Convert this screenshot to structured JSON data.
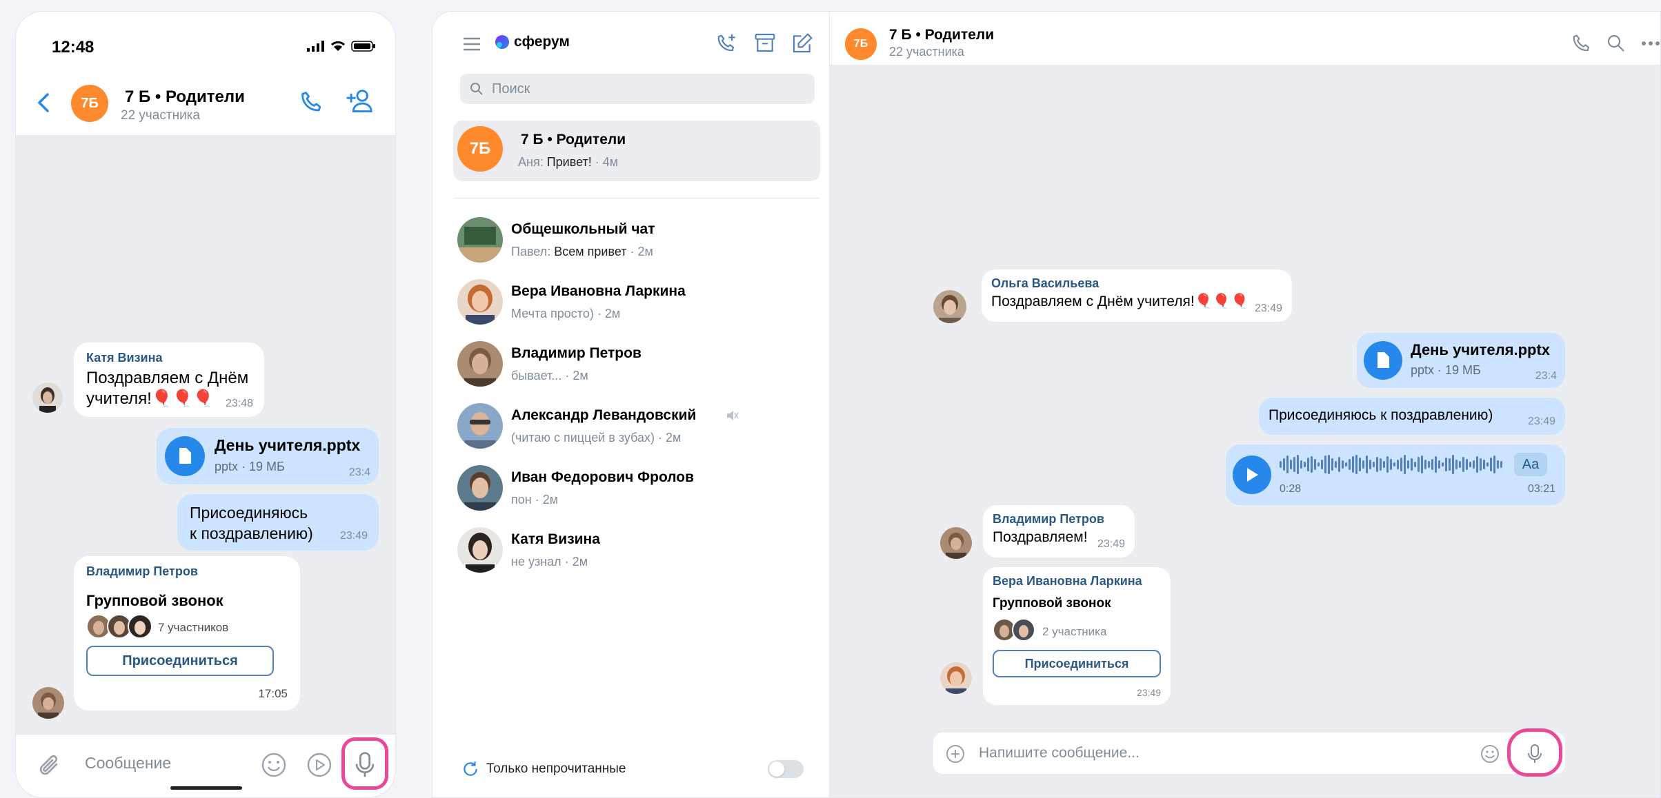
{
  "colors": {
    "accent": "#2688eb",
    "group_avatar": "#ff8a2e",
    "bubble_out": "#cce4ff",
    "bubble_in": "#ffffff",
    "chat_bg": "#ebedf0",
    "highlight": "#ec4899"
  },
  "phone": {
    "status": {
      "time": "12:48"
    },
    "header": {
      "avatar": "7Б",
      "title": "7 Б • Родители",
      "subtitle": "22 участника"
    },
    "messages": {
      "m1": {
        "sender": "Катя Визина",
        "line1": "Поздравляем с Днём",
        "line2": "учителя!🎈🎈🎈",
        "time": "23:48"
      },
      "m2": {
        "file": "День учителя.pptx",
        "meta": "pptx · 19 МБ",
        "time": "23:4"
      },
      "m3": {
        "line1": "Присоединяюсь",
        "line2": "к поздравлению)",
        "time": "23:49"
      },
      "m4": {
        "sender": "Владимир Петров",
        "title": "Групповой звонок",
        "participants": "7 участников",
        "button": "Присоединиться",
        "time": "17:05"
      }
    },
    "input": {
      "placeholder": "Сообщение"
    }
  },
  "desktop": {
    "brand": "сферум",
    "search_placeholder": "Поиск",
    "conversations": [
      {
        "avatar": "7Б",
        "name": "7 Б • Родители",
        "author": "Аня:",
        "text": "Привет!",
        "time": "· 4м"
      },
      {
        "name": "Общешкольный чат",
        "author": "Павел:",
        "text": "Всем привет",
        "time": "· 2м"
      },
      {
        "name": "Вера Ивановна Ларкина",
        "author": "",
        "text": "Мечта просто)",
        "time": "· 2м"
      },
      {
        "name": "Владимир Петров",
        "author": "",
        "text": "бывает...",
        "time": "· 2м"
      },
      {
        "name": "Александр Левандовский",
        "author": "",
        "text": "(читаю с пиццей в зубах)",
        "time": "· 2м"
      },
      {
        "name": "Иван Федорович Фролов",
        "author": "",
        "text": "пон",
        "time": "· 2м"
      },
      {
        "name": "Катя Визина",
        "author": "",
        "text": "не узнал",
        "time": "· 2м"
      }
    ],
    "unread_toggle_label": "Только непрочитанные",
    "chat": {
      "avatar": "7Б",
      "title": "7 Б • Родители",
      "subtitle": "22 участника",
      "m1": {
        "sender": "Ольга Васильева",
        "text": "Поздравляем с Днём учителя!🎈🎈🎈",
        "time": "23:49"
      },
      "m2": {
        "file": "День учителя.pptx",
        "meta": "pptx · 19 МБ",
        "time": "23:4"
      },
      "m3": {
        "text": "Присоединяюсь к поздравлению)",
        "time": "23:49"
      },
      "m4": {
        "elapsed": "0:28",
        "duration": "03:21",
        "transcribe": "Aa"
      },
      "m5": {
        "sender": "Владимир Петров",
        "text": "Поздравляем!",
        "time": "23:49"
      },
      "m6": {
        "sender": "Вера Ивановна Ларкина",
        "title": "Групповой звонок",
        "participants": "2 участника",
        "button": "Присоединиться",
        "time": "23:49"
      },
      "input_placeholder": "Напишите сообщение..."
    }
  }
}
